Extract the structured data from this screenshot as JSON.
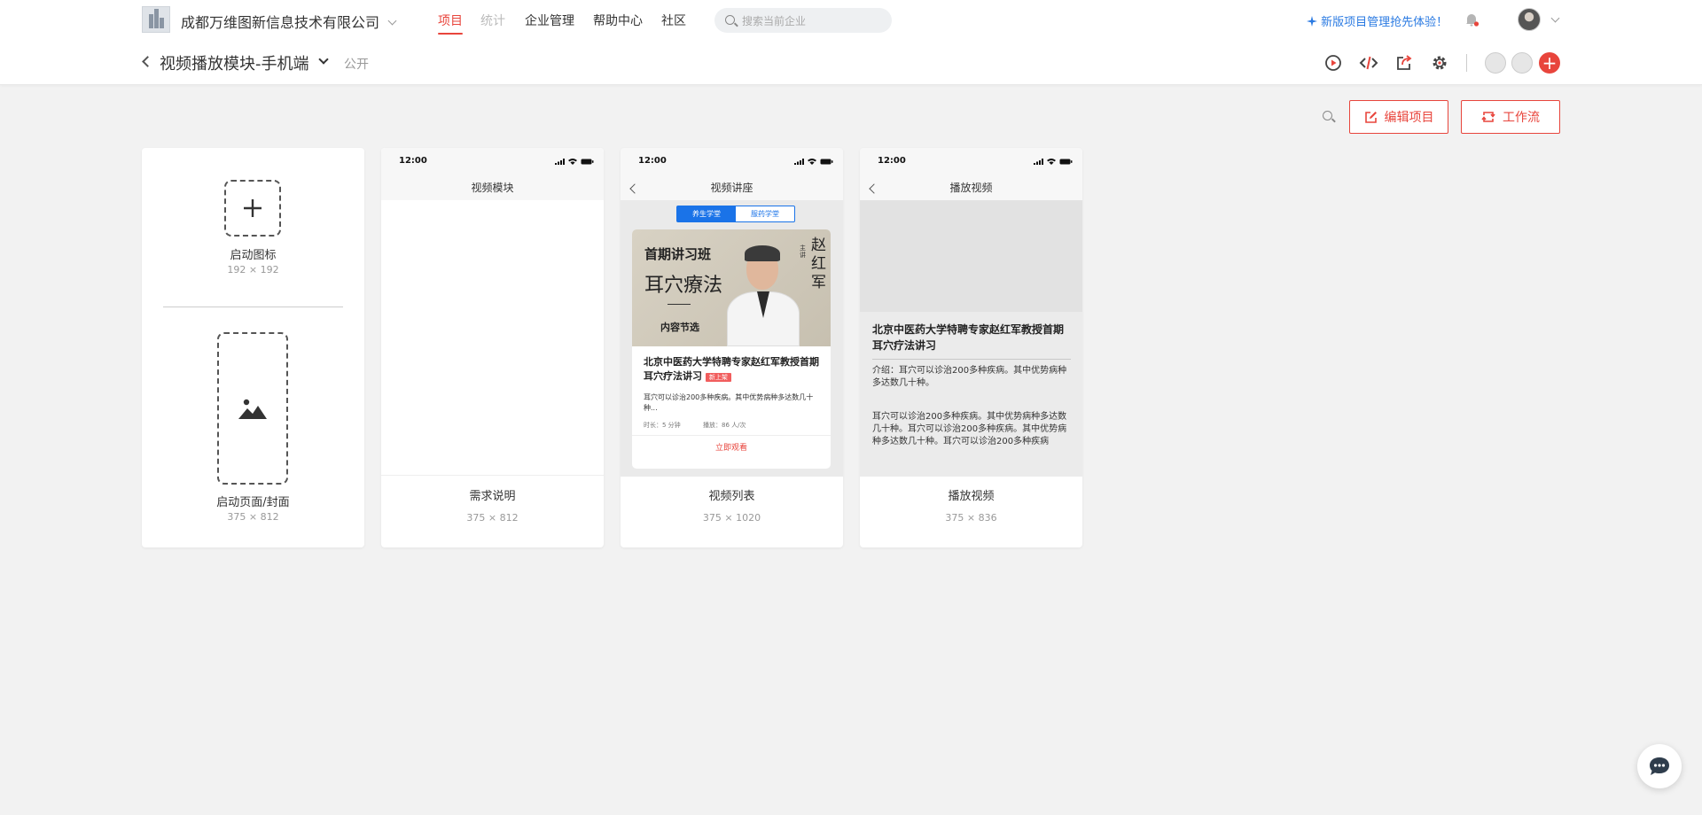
{
  "header": {
    "company": "成都万维图新信息技术有限公司",
    "nav": [
      "项目",
      "统计",
      "企业管理",
      "帮助中心",
      "社区"
    ],
    "search_placeholder": "搜索当前企业",
    "promo": "新版项目管理抢先体验！"
  },
  "project": {
    "title": "视频播放模块-手机端",
    "visibility": "公开"
  },
  "actions": {
    "edit": "编辑项目",
    "workflow": "工作流"
  },
  "launch": {
    "icon_label": "启动图标",
    "icon_size": "192 × 192",
    "cover_label": "启动页面/封面",
    "cover_size": "375 × 812"
  },
  "screens": [
    {
      "name": "需求说明",
      "size": "375 × 812",
      "time": "12:00",
      "title": "视频模块"
    },
    {
      "name": "视频列表",
      "size": "375 × 1020",
      "time": "12:00",
      "title": "视频讲座",
      "tabs": [
        "养生学堂",
        "服药学堂"
      ],
      "poster": {
        "line1": "首期讲习班",
        "line2": "耳穴療法",
        "line3": "内容节选",
        "side": [
          "赵",
          "红",
          "军"
        ],
        "side2": "主讲"
      },
      "video_title": "北京中医药大学特聘专家赵红军教授首期耳穴疗法讲习",
      "badge": "新上架",
      "desc": "耳穴可以诊治200多种疾病。其中优势病种多达数几十种...",
      "duration": "时长：5 分钟",
      "plays": "播放：86 人/次",
      "watch": "立即观看"
    },
    {
      "name": "播放视频",
      "size": "375 × 836",
      "time": "12:00",
      "title": "播放视频",
      "video_title": "北京中医药大学特聘专家赵红军教授首期耳穴疗法讲习",
      "intro": "介绍：耳穴可以诊治200多种疾病。其中优势病种多达数几十种。",
      "body": "耳穴可以诊治200多种疾病。其中优势病种多达数几十种。耳穴可以诊治200多种疾病。其中优势病种多达数几十种。耳穴可以诊治200多种疾病"
    }
  ],
  "colors": {
    "accent": "#e8453c",
    "link": "#2a7ae2",
    "tab_blue": "#1a73e8"
  }
}
